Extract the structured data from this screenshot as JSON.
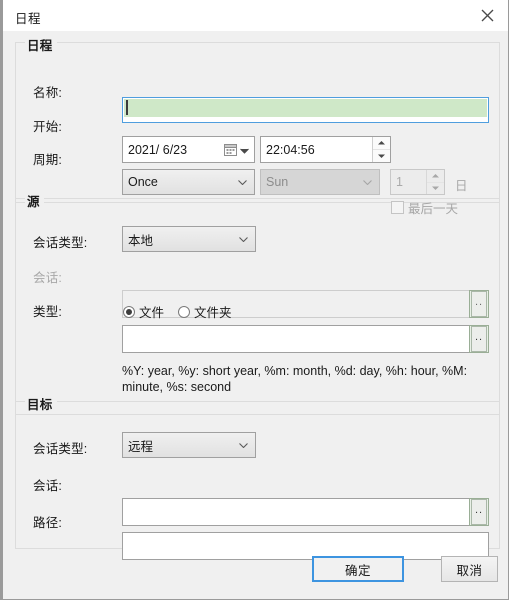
{
  "window": {
    "title": "日程",
    "close_icon": "close-icon"
  },
  "schedule_group": {
    "title": "日程",
    "name_label": "名称:",
    "name_value": "",
    "start_label": "开始:",
    "date_value": "2021/ 6/23",
    "date_icon": "calendar-icon",
    "time_value": "22:04:56",
    "period_label": "周期:",
    "period_value": "Once",
    "weekday_value": "Sun",
    "day_count_value": "1",
    "day_unit_label": "日",
    "last_day_label": "最后一天"
  },
  "source_group": {
    "title": "源",
    "session_type_label": "会话类型:",
    "session_type_value": "本地",
    "session_label": "会话:",
    "session_value": "",
    "browse_label": "..",
    "type_label": "类型:",
    "radio_file_label": "文件",
    "radio_folder_label": "文件夹",
    "path_value": "",
    "help_text": "%Y: year, %y: short year, %m: month, %d: day, %h: hour, %M: minute, %s: second"
  },
  "target_group": {
    "title": "目标",
    "session_type_label": "会话类型:",
    "session_type_value": "远程",
    "session_label": "会话:",
    "session_value": "",
    "browse_label": "..",
    "path_label": "路径:",
    "path_value": ""
  },
  "footer": {
    "ok_label": "确定",
    "cancel_label": "取消"
  },
  "colors": {
    "accent": "#3d94e0",
    "focus_fill": "#cfe8c8",
    "dialog_bg": "#f0f0f0"
  }
}
